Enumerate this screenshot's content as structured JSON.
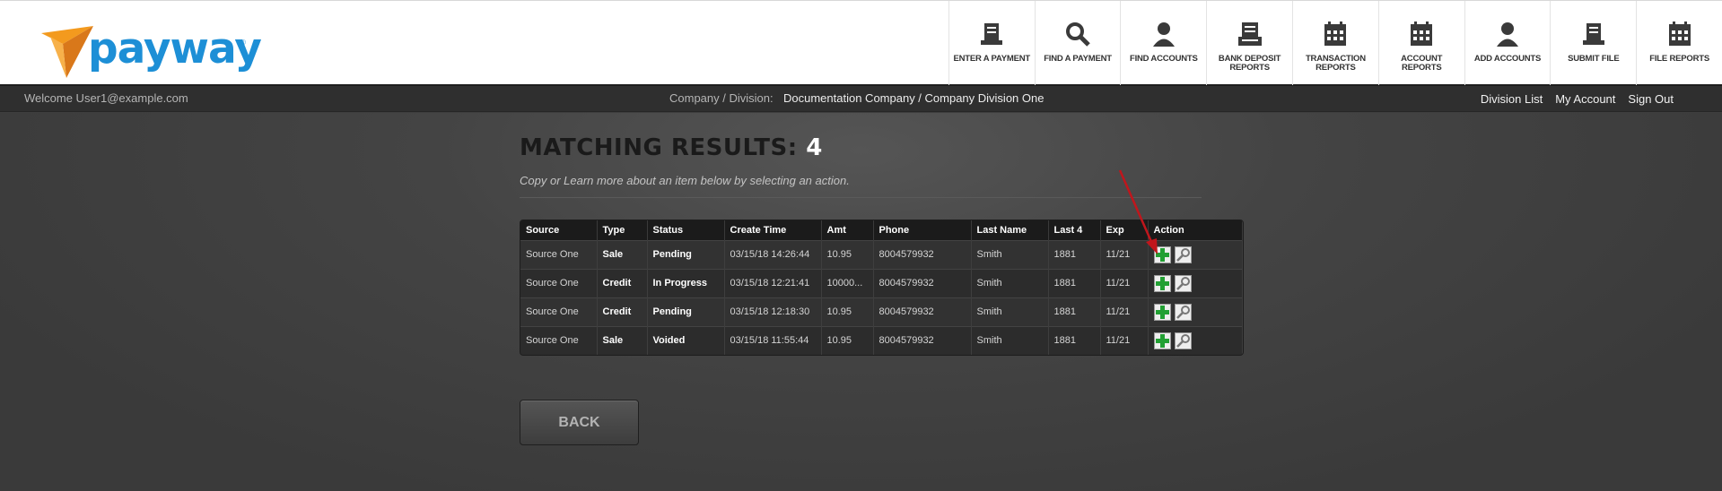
{
  "header": {
    "logo_text": "payway",
    "logo_reg": "®",
    "nav": [
      {
        "label": "Enter a Payment",
        "icon": "receipt-icon"
      },
      {
        "label": "Find a Payment",
        "icon": "search-icon"
      },
      {
        "label": "Find Accounts",
        "icon": "user-icon"
      },
      {
        "label": "Bank Deposit Reports",
        "icon": "bank-deposit-icon"
      },
      {
        "label": "Transaction Reports",
        "icon": "calendar-icon"
      },
      {
        "label": "Account Reports",
        "icon": "calendar-icon"
      },
      {
        "label": "Add Accounts",
        "icon": "user-icon"
      },
      {
        "label": "Submit File",
        "icon": "receipt-icon"
      },
      {
        "label": "File Reports",
        "icon": "calendar-icon"
      }
    ]
  },
  "subbar": {
    "welcome": "Welcome User1@example.com",
    "company_label": "Company / Division:",
    "company_value": "Documentation Company / Company Division One",
    "links": [
      "Division List",
      "My Account",
      "Sign Out"
    ]
  },
  "main": {
    "title": "MATCHING RESULTS:",
    "count": "4",
    "subtitle": "Copy or Learn more about an item below by selecting an action.",
    "back_label": "BACK"
  },
  "table": {
    "columns": [
      "Source",
      "Type",
      "Status",
      "Create Time",
      "Amt",
      "Phone",
      "Last Name",
      "Last 4",
      "Exp",
      "Action"
    ],
    "rows": [
      [
        "Source One",
        "Sale",
        "Pending",
        "03/15/18 14:26:44",
        "10.95",
        "8004579932",
        "Smith",
        "1881",
        "11/21"
      ],
      [
        "Source One",
        "Credit",
        "In Progress",
        "03/15/18 12:21:41",
        "10000...",
        "8004579932",
        "Smith",
        "1881",
        "11/21"
      ],
      [
        "Source One",
        "Credit",
        "Pending",
        "03/15/18 12:18:30",
        "10.95",
        "8004579932",
        "Smith",
        "1881",
        "11/21"
      ],
      [
        "Source One",
        "Sale",
        "Voided",
        "03/15/18 11:55:44",
        "10.95",
        "8004579932",
        "Smith",
        "1881",
        "11/21"
      ]
    ]
  },
  "colors": {
    "brand_blue": "#1d8fd6",
    "brand_orange": "#f39a1e",
    "annotation_red": "#c0161c",
    "plus_green": "#22a033"
  }
}
